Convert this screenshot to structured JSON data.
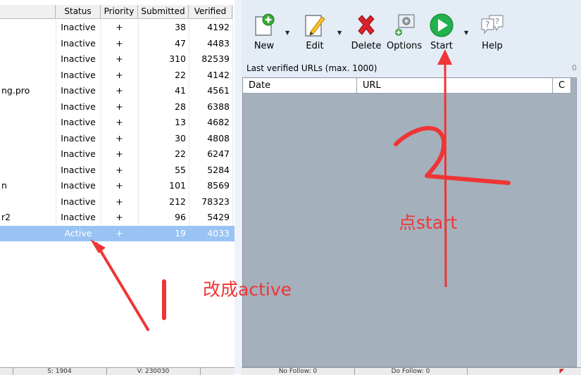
{
  "projects_table": {
    "columns": [
      "Status",
      "Priority",
      "Submitted",
      "Verified"
    ],
    "rows": [
      {
        "name": "",
        "status": "Inactive",
        "priority": "+",
        "submitted": "38",
        "verified": "4192"
      },
      {
        "name": "",
        "status": "Inactive",
        "priority": "+",
        "submitted": "47",
        "verified": "4483"
      },
      {
        "name": "",
        "status": "Inactive",
        "priority": "+",
        "submitted": "310",
        "verified": "82539"
      },
      {
        "name": "",
        "status": "Inactive",
        "priority": "+",
        "submitted": "22",
        "verified": "4142"
      },
      {
        "name": "ng.pro",
        "status": "Inactive",
        "priority": "+",
        "submitted": "41",
        "verified": "4561"
      },
      {
        "name": "",
        "status": "Inactive",
        "priority": "+",
        "submitted": "28",
        "verified": "6388"
      },
      {
        "name": "",
        "status": "Inactive",
        "priority": "+",
        "submitted": "13",
        "verified": "4682"
      },
      {
        "name": "",
        "status": "Inactive",
        "priority": "+",
        "submitted": "30",
        "verified": "4808"
      },
      {
        "name": "",
        "status": "Inactive",
        "priority": "+",
        "submitted": "22",
        "verified": "6247"
      },
      {
        "name": "",
        "status": "Inactive",
        "priority": "+",
        "submitted": "55",
        "verified": "5284"
      },
      {
        "name": "n",
        "status": "Inactive",
        "priority": "+",
        "submitted": "101",
        "verified": "8569"
      },
      {
        "name": "",
        "status": "Inactive",
        "priority": "+",
        "submitted": "212",
        "verified": "78323"
      },
      {
        "name": "r2",
        "status": "Inactive",
        "priority": "+",
        "submitted": "96",
        "verified": "5429"
      },
      {
        "name": "",
        "status": "Active",
        "priority": "+",
        "submitted": "19",
        "verified": "4033",
        "selected": true
      }
    ]
  },
  "status_bar": {
    "left_items": [
      "S: 1904",
      "V: 230030"
    ],
    "right_items": [
      "No Follow: 0",
      "Do Follow: 0"
    ]
  },
  "toolbar": {
    "new_label": "New",
    "edit_label": "Edit",
    "delete_label": "Delete",
    "options_label": "Options",
    "start_label": "Start",
    "help_label": "Help"
  },
  "verified_panel": {
    "title": "Last verified URLs (max. 1000)",
    "count": "0",
    "columns": [
      "Date",
      "URL",
      "C"
    ]
  },
  "annotations": {
    "step1_label": "改成active",
    "step2_label": "点start",
    "color": "#ef3535"
  }
}
